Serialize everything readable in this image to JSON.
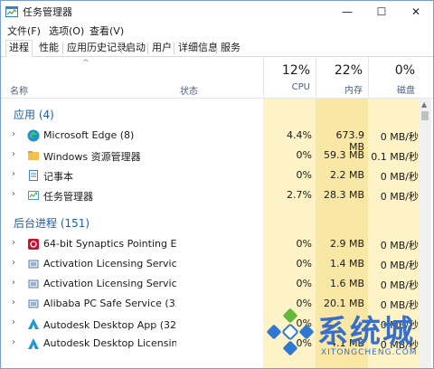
{
  "title": "任务管理器",
  "window_controls": {
    "min": "—",
    "max": "☐",
    "close": "✕"
  },
  "menu": [
    "文件(F)",
    "选项(O)",
    "查看(V)"
  ],
  "tabs": [
    "进程",
    "性能",
    "应用历史记录",
    "启动",
    "用户",
    "详细信息",
    "服务"
  ],
  "header": {
    "name": "名称",
    "status": "状态",
    "cpu_pct": "12%",
    "cpu_label": "CPU",
    "mem_pct": "22%",
    "mem_label": "内存",
    "disk_pct": "0%",
    "disk_label": "磁盘",
    "sort_arrow": "^"
  },
  "groups": {
    "apps": "应用 (4)",
    "background": "后台进程 (151)"
  },
  "apps": [
    {
      "name": "Microsoft Edge (8)",
      "icon": "edge-icon",
      "cpu": "4.4%",
      "mem": "673.9 MB",
      "disk": "0 MB/秒"
    },
    {
      "name": "Windows 资源管理器",
      "icon": "folder-icon",
      "cpu": "0%",
      "mem": "59.3 MB",
      "disk": "0.1 MB/秒"
    },
    {
      "name": "记事本",
      "icon": "notepad-icon",
      "cpu": "0%",
      "mem": "2.2 MB",
      "disk": "0 MB/秒"
    },
    {
      "name": "任务管理器",
      "icon": "taskmgr-icon",
      "cpu": "2.7%",
      "mem": "28.3 MB",
      "disk": "0 MB/秒"
    }
  ],
  "background": [
    {
      "name": "64-bit Synaptics Pointing Enh...",
      "icon": "synaptics-icon",
      "cpu": "0%",
      "mem": "2.9 MB",
      "disk": "0 MB/秒"
    },
    {
      "name": "Activation Licensing Service",
      "icon": "service-icon",
      "cpu": "0%",
      "mem": "1.4 MB",
      "disk": "0 MB/秒"
    },
    {
      "name": "Activation Licensing Service (...",
      "icon": "service-icon",
      "cpu": "0%",
      "mem": "1.6 MB",
      "disk": "0 MB/秒"
    },
    {
      "name": "Alibaba PC Safe Service (32 ...",
      "icon": "service-icon",
      "cpu": "0%",
      "mem": "20.1 MB",
      "disk": "0 MB/秒"
    },
    {
      "name": "Autodesk Desktop App (32 位)",
      "icon": "autodesk-icon",
      "cpu": "0%",
      "mem": "",
      "disk": "0 MB/秒"
    },
    {
      "name": "Autodesk Desktop Licensing ...",
      "icon": "autodesk-icon",
      "cpu": "0%",
      "mem": "4.1 MB",
      "disk": "0 MB/秒"
    }
  ],
  "watermark": {
    "big": "系统城",
    "small": "XITONGCHENG.COM"
  },
  "colors": {
    "cpu_bg": "#fdf3c6",
    "mem_bg": "#f9e7a6",
    "disk_bg": "#fdf3c6",
    "group": "#1f5ea8"
  }
}
